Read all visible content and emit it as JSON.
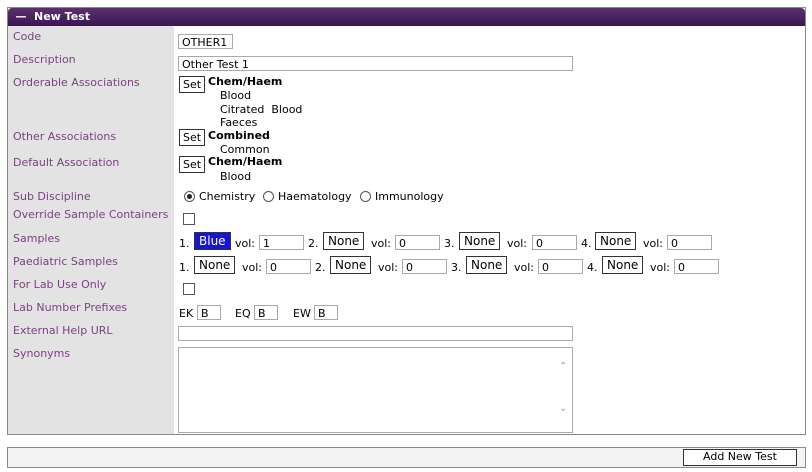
{
  "panel": {
    "title": "New Test",
    "collapse_symbol": "—"
  },
  "labels": {
    "code": "Code",
    "description": "Description",
    "orderable_associations": "Orderable Associations",
    "other_associations": "Other Associations",
    "default_association": "Default Association",
    "sub_discipline": "Sub Discipline",
    "override_sample_containers": "Override Sample Containers",
    "samples": "Samples",
    "paediatric_samples": "Paediatric Samples",
    "for_lab_use_only": "For Lab Use Only",
    "lab_number_prefixes": "Lab Number Prefixes",
    "external_help_url": "External Help URL",
    "synonyms": "Synonyms"
  },
  "fields": {
    "code": "OTHER1",
    "description": "Other Test 1",
    "external_help_url": "",
    "synonyms": ""
  },
  "set_label": "Set",
  "orderable": {
    "heading": "Chem/Haem",
    "items": [
      "Blood",
      "Citrated  Blood",
      "Faeces"
    ]
  },
  "other": {
    "heading": "Combined",
    "items": [
      "Common"
    ]
  },
  "default": {
    "heading": "Chem/Haem",
    "items": [
      "Blood"
    ]
  },
  "sub_discipline": {
    "options": [
      "Chemistry",
      "Haematology",
      "Immunology"
    ],
    "selected": "Chemistry"
  },
  "override_sample_containers": false,
  "for_lab_use_only": false,
  "vol_label": "vol:",
  "samples": [
    {
      "num": "1.",
      "color": "Blue",
      "vol": "1"
    },
    {
      "num": "2.",
      "color": "None",
      "vol": "0"
    },
    {
      "num": "3.",
      "color": "None",
      "vol": "0"
    },
    {
      "num": "4.",
      "color": "None",
      "vol": "0"
    }
  ],
  "paediatric_samples": [
    {
      "num": "1.",
      "color": "None",
      "vol": "0"
    },
    {
      "num": "2.",
      "color": "None",
      "vol": "0"
    },
    {
      "num": "3.",
      "color": "None",
      "vol": "0"
    },
    {
      "num": "4.",
      "color": "None",
      "vol": "0"
    }
  ],
  "lab_prefixes": [
    {
      "label": "EK",
      "value": "B"
    },
    {
      "label": "EQ",
      "value": "B"
    },
    {
      "label": "EW",
      "value": "B"
    }
  ],
  "footer": {
    "add_button": "Add New Test"
  },
  "colors": {
    "title_bar": "#4a2262",
    "label_text": "#7c3f84",
    "label_bg": "#e3e3e3",
    "sample_blue": "#1515d6"
  }
}
